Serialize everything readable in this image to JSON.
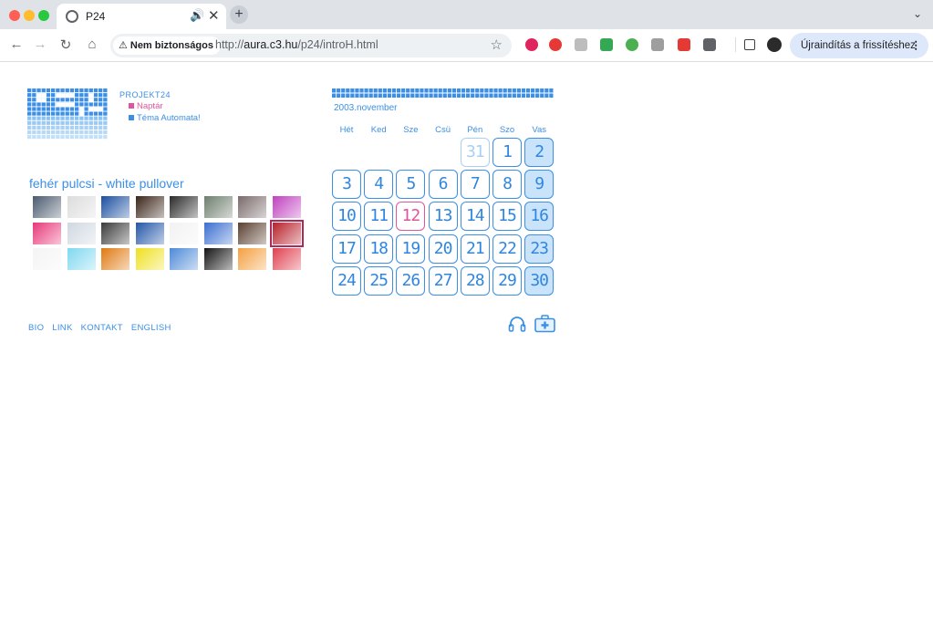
{
  "browser": {
    "tab_title": "P24",
    "tab_close": "✕",
    "tab_audio": "🔊",
    "new_tab": "+",
    "tab_menu": "⌄",
    "nav": {
      "back": "←",
      "forward": "→",
      "reload": "↻",
      "home": "⌂"
    },
    "security_chip": "Nem biztonságos",
    "security_icon": "warning-triangle-icon",
    "url_prefix": "http://",
    "url_host": "aura.c3.hu",
    "url_path": "/p24/introH.html",
    "star": "☆",
    "restart_label": "Újraindítás a frissítéshez",
    "restart_menu": "⋮",
    "extension_colors": [
      "#e0245e",
      "#e53935",
      "#bdbdbd",
      "#34a853",
      "#4caf50",
      "#9e9e9e",
      "#e53935",
      "#5f6368"
    ]
  },
  "site": {
    "brand": "PROJEKT24",
    "menu": [
      {
        "label": "Naptár",
        "color": "#e2549a"
      },
      {
        "label": "Téma Automata!",
        "color": "#3b8fe6"
      }
    ],
    "subject": "fehér pulcsi - white pullover",
    "thumb_colors": [
      [
        "#4a5a6e",
        "#dcdcdc",
        "#1a4fa0",
        "#3a2418",
        "#2a2a2a",
        "#6e7e6e",
        "#7a6a6a",
        "#c040c0"
      ],
      [
        "#e8387a",
        "#cfd8e0",
        "#3a3a3a",
        "#2456a8",
        "#f2f2f2",
        "#3b6fd0",
        "#5a4030",
        "#b8202a"
      ],
      [
        "#f4f4f4",
        "#7fd8f0",
        "#e07a10",
        "#f0e020",
        "#4d8ad8",
        "#141414",
        "#f4a040",
        "#e04050"
      ]
    ],
    "calendar": {
      "month_label": "2003.november",
      "day_names": [
        "Hét",
        "Ked",
        "Sze",
        "Csü",
        "Pén",
        "Szo",
        "Vas"
      ],
      "weeks": [
        [
          "",
          "",
          "",
          "",
          "31",
          "1",
          "2"
        ],
        [
          "3",
          "4",
          "5",
          "6",
          "7",
          "8",
          "9"
        ],
        [
          "10",
          "11",
          "12",
          "13",
          "14",
          "15",
          "16"
        ],
        [
          "17",
          "18",
          "19",
          "20",
          "21",
          "22",
          "23"
        ],
        [
          "24",
          "25",
          "26",
          "27",
          "28",
          "29",
          "30"
        ]
      ],
      "today": "12",
      "other_month": "31",
      "accent_color": "#3b8fe6",
      "today_color": "#e2549a",
      "weekend_fill": "#c9e4fa"
    },
    "footer_links": [
      "BIO",
      "LINK",
      "KONTAKT",
      "ENGLISH"
    ],
    "footer_icons": [
      "headphones-icon",
      "first-aid-kit-icon"
    ]
  }
}
